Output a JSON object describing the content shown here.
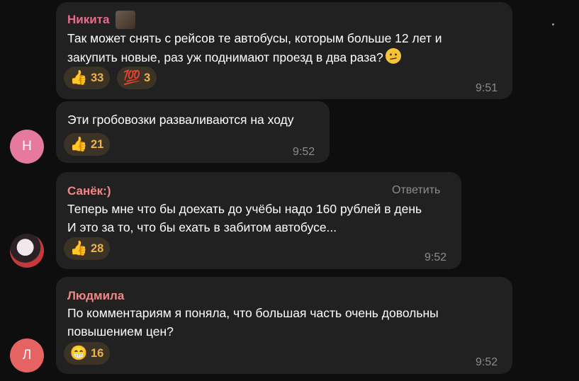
{
  "messages": [
    {
      "author": "Никита",
      "author_color": "#e86b8d",
      "text": "Так может снять с рейсов те автобусы, которым больше 12 лет и\nзакупить новые, раз уж поднимают проезд в два раза?",
      "reactions": [
        {
          "emoji": "👍",
          "count": "33",
          "icon": "thumbs-up-icon"
        },
        {
          "emoji": "💯",
          "count": "3",
          "icon": "hundred-points-icon"
        }
      ],
      "time": "9:51"
    },
    {
      "author": "",
      "text": "Эти гробовозки разваливаются на ходу",
      "reactions": [
        {
          "emoji": "👍",
          "count": "21",
          "icon": "thumbs-up-icon"
        }
      ],
      "time": "9:52",
      "avatar_letter": "Н",
      "avatar_color": "#e57a9e"
    },
    {
      "author": "Санёк:)",
      "author_color": "#f08888",
      "reply_label": "Ответить",
      "text": "Теперь мне что бы доехать до учёбы надо 160 рублей в день\nИ это за то, что бы ехать в забитом автобусе...",
      "reactions": [
        {
          "emoji": "👍",
          "count": "28",
          "icon": "thumbs-up-icon"
        }
      ],
      "time": "9:52"
    },
    {
      "author": "Людмила",
      "author_color": "#f08888",
      "text": "По комментариям я поняла, что большая часть очень довольны\nповышением цен?",
      "reactions": [
        {
          "emoji": "😁",
          "count": "16",
          "icon": "grinning-face-icon"
        }
      ],
      "time": "9:52",
      "avatar_letter": "Л",
      "avatar_color": "#e56363"
    }
  ]
}
